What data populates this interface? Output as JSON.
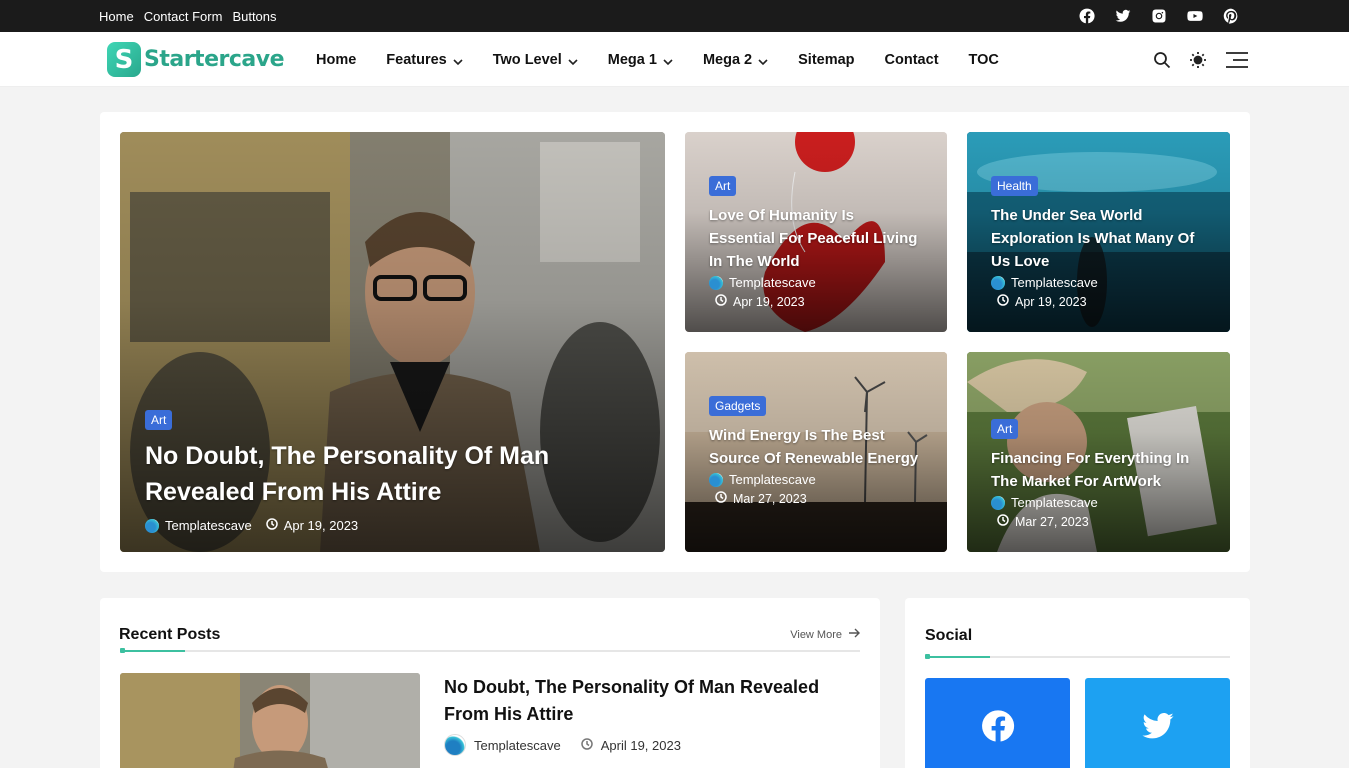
{
  "topbar": {
    "links": [
      "Home",
      "Contact Form",
      "Buttons"
    ],
    "social_icons": [
      "facebook-icon",
      "twitter-icon",
      "instagram-icon",
      "youtube-icon",
      "pinterest-icon"
    ]
  },
  "header": {
    "logo_letter": "S",
    "logo_text": "Startercave",
    "nav": [
      {
        "label": "Home",
        "dropdown": false
      },
      {
        "label": "Features",
        "dropdown": true
      },
      {
        "label": "Two Level",
        "dropdown": true
      },
      {
        "label": "Mega 1",
        "dropdown": true
      },
      {
        "label": "Mega 2",
        "dropdown": true
      },
      {
        "label": "Sitemap",
        "dropdown": false
      },
      {
        "label": "Contact",
        "dropdown": false
      },
      {
        "label": "TOC",
        "dropdown": false
      }
    ],
    "icons": [
      "search-icon",
      "sun-icon",
      "menu-icon"
    ]
  },
  "featured": {
    "main": {
      "category": "Art",
      "title": "No Doubt, The Personality Of Man Revealed From His Attire",
      "author": "Templatescave",
      "date": "Apr 19, 2023"
    },
    "cards": [
      {
        "category": "Art",
        "title": "Love Of Humanity Is Essential For Peaceful Living In The World",
        "author": "Templatescave",
        "date": "Apr 19, 2023"
      },
      {
        "category": "Health",
        "title": "The Under Sea World Exploration Is What Many Of Us Love",
        "author": "Templatescave",
        "date": "Apr 19, 2023"
      },
      {
        "category": "Gadgets",
        "title": "Wind Energy Is The Best Source Of Renewable Energy",
        "author": "Templatescave",
        "date": "Mar 27, 2023"
      },
      {
        "category": "Art",
        "title": "Financing For Everything In The Market For ArtWork",
        "author": "Templatescave",
        "date": "Mar 27, 2023"
      }
    ]
  },
  "recent": {
    "heading": "Recent Posts",
    "view_more": "View More",
    "post": {
      "title": "No Doubt, The Personality Of Man Revealed From His Attire",
      "author": "Templatescave",
      "date": "April 19, 2023"
    }
  },
  "social": {
    "heading": "Social",
    "tiles": [
      {
        "icon": "facebook-icon",
        "color": "#1877f2"
      },
      {
        "icon": "twitter-icon",
        "color": "#1da1f2"
      }
    ]
  },
  "colors": {
    "accent": "#3cc0a0",
    "badge": "#3a6dd8",
    "topbar": "#1b1b1b"
  }
}
